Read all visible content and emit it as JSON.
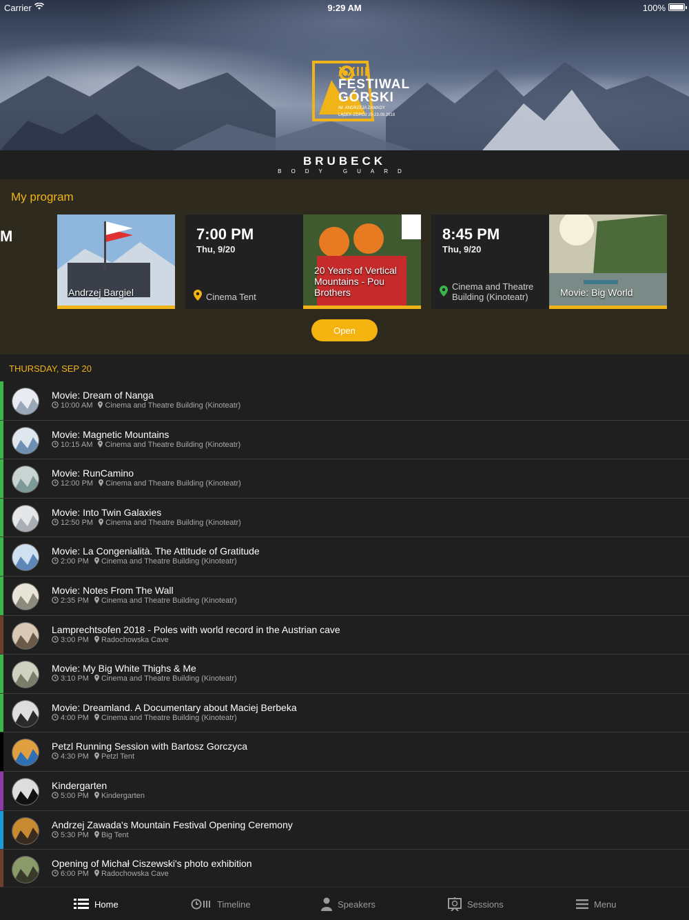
{
  "status_bar": {
    "carrier": "Carrier",
    "time": "9:29 AM",
    "battery": "100%"
  },
  "hero": {
    "numeral": "XXIII",
    "title_line1": "FESTIWAL",
    "title_line2": "GÓRSKI",
    "sub_line1": "IM. ANDRZEJA ZAWADY",
    "sub_line2": "LĄDEK-ZDRÓJ 20-23.09.2018",
    "accent": "#f0b418"
  },
  "sponsor": {
    "name": "BRUBECK",
    "sub": "BODY GUARD"
  },
  "my_program": {
    "title": "My program",
    "partial_label": "M",
    "cards": [
      {
        "caption": "Andrzej Bargiel"
      },
      {
        "time": "7:00 PM",
        "date": "Thu, 9/20",
        "location": "Cinema Tent"
      },
      {
        "caption": "20 Years of Vertical Mountains - Pou Brothers"
      },
      {
        "time": "8:45 PM",
        "date": "Thu, 9/20",
        "location": "Cinema and Theatre Building (Kinoteatr)"
      },
      {
        "caption": "Movie: Big World"
      }
    ],
    "open_button": "Open"
  },
  "schedule": {
    "day_header": "THURSDAY, SEP 20",
    "items": [
      {
        "title": "Movie: Dream of Nanga",
        "time": "10:00 AM",
        "place": "Cinema and Theatre Building (Kinoteatr)",
        "color": "#39b54a"
      },
      {
        "title": "Movie: Magnetic Mountains",
        "time": "10:15 AM",
        "place": "Cinema and Theatre Building (Kinoteatr)",
        "color": "#39b54a"
      },
      {
        "title": "Movie: RunCamino",
        "time": "12:00 PM",
        "place": "Cinema and Theatre Building (Kinoteatr)",
        "color": "#39b54a"
      },
      {
        "title": "Movie: Into Twin Galaxies",
        "time": "12:50 PM",
        "place": "Cinema and Theatre Building (Kinoteatr)",
        "color": "#39b54a"
      },
      {
        "title": "Movie: La Congenialità. The Attitude of Gratitude",
        "time": "2:00 PM",
        "place": "Cinema and Theatre Building (Kinoteatr)",
        "color": "#39b54a"
      },
      {
        "title": "Movie: Notes From The Wall",
        "time": "2:35 PM",
        "place": "Cinema and Theatre Building (Kinoteatr)",
        "color": "#39b54a"
      },
      {
        "title": "Lamprechtsofen 2018 - Poles with world record in the Austrian cave",
        "time": "3:00 PM",
        "place": "Radochowska Cave",
        "color": "#6b3f2a"
      },
      {
        "title": "Movie: My Big White Thighs & Me",
        "time": "3:10 PM",
        "place": "Cinema and Theatre Building (Kinoteatr)",
        "color": "#39b54a"
      },
      {
        "title": "Movie: Dreamland. A Documentary about Maciej Berbeka",
        "time": "4:00 PM",
        "place": "Cinema and Theatre Building (Kinoteatr)",
        "color": "#39b54a"
      },
      {
        "title": "Petzl Running Session with Bartosz Gorczyca",
        "time": "4:30 PM",
        "place": "Petzl Tent",
        "color": "#000000"
      },
      {
        "title": "Kindergarten",
        "time": "5:00 PM",
        "place": "Kindergarten",
        "color": "#8e3aa8"
      },
      {
        "title": "Andrzej Zawada's Mountain Festival Opening Ceremony",
        "time": "5:30 PM",
        "place": "Big Tent",
        "color": "#1e9ad6"
      },
      {
        "title": "Opening of Michał Ciszewski's photo exhibition",
        "time": "6:00 PM",
        "place": "Radochowska Cave",
        "color": "#6b3f2a"
      }
    ]
  },
  "tabs": [
    {
      "label": "Home",
      "icon": "home-list-icon",
      "active": true
    },
    {
      "label": "Timeline",
      "icon": "timeline-icon",
      "active": false
    },
    {
      "label": "Speakers",
      "icon": "speaker-icon",
      "active": false
    },
    {
      "label": "Sessions",
      "icon": "sessions-icon",
      "active": false
    },
    {
      "label": "Menu",
      "icon": "menu-icon",
      "active": false
    }
  ]
}
